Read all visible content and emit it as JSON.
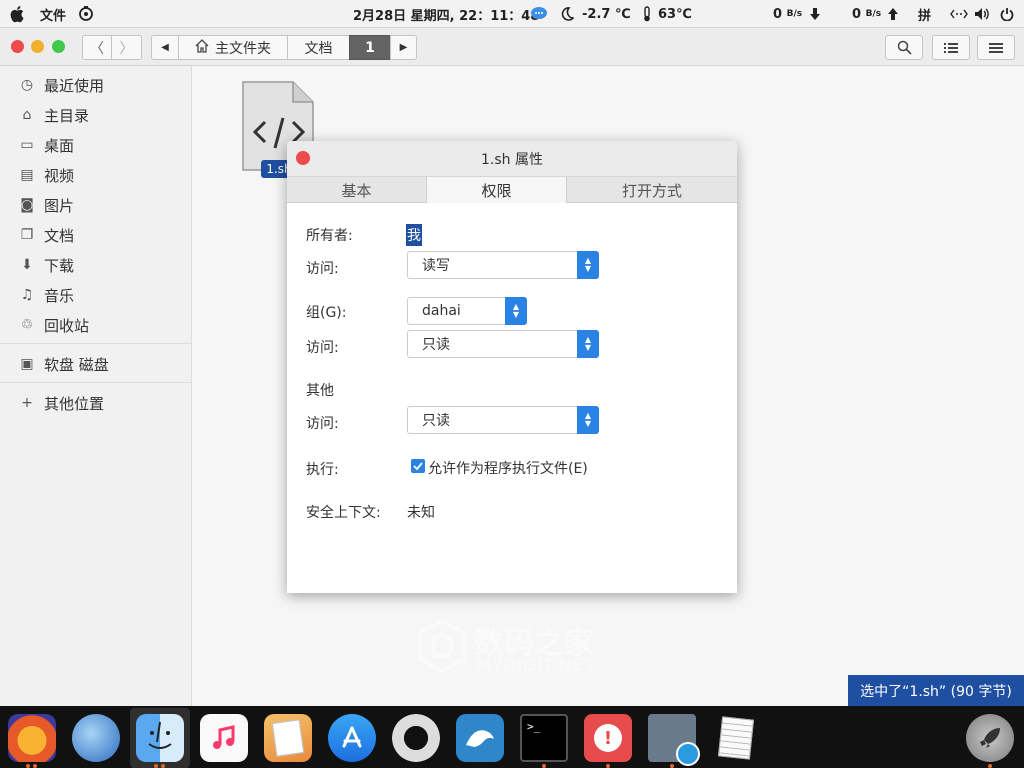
{
  "topbar": {
    "menu": "文件",
    "datetime": "2月28日 星期四, 22：11：48",
    "weather": "-2.7 ℃",
    "temp": "63℃",
    "net_down": "0",
    "net_down_unit": "B/s",
    "net_up": "0",
    "net_up_unit": "B/s",
    "ime": "拼"
  },
  "fm": {
    "breadcrumb": [
      "主文件夹",
      "文档",
      "1"
    ],
    "sidebar": [
      {
        "label": "最近使用",
        "icon": "recent-icon"
      },
      {
        "label": "主目录",
        "icon": "home-icon"
      },
      {
        "label": "桌面",
        "icon": "desktop-icon"
      },
      {
        "label": "视频",
        "icon": "video-icon"
      },
      {
        "label": "图片",
        "icon": "pictures-icon"
      },
      {
        "label": "文档",
        "icon": "documents-icon"
      },
      {
        "label": "下载",
        "icon": "downloads-icon"
      },
      {
        "label": "音乐",
        "icon": "music-icon"
      },
      {
        "label": "回收站",
        "icon": "trash-icon"
      },
      {
        "label": "软盘 磁盘",
        "icon": "floppy-icon"
      },
      {
        "label": "其他位置",
        "icon": "plus-icon"
      }
    ],
    "file_label": "1.sh",
    "status": "选中了“1.sh” (90 字节)"
  },
  "dialog": {
    "title": "1.sh 属性",
    "tabs": [
      "基本",
      "权限",
      "打开方式"
    ],
    "active_tab": "权限",
    "owner_label": "所有者:",
    "owner_value": "我",
    "access_label": "访问:",
    "owner_access": "读写",
    "group_label": "组(G):",
    "group_value": "dahai",
    "group_access": "只读",
    "others_label": "其他",
    "others_access": "只读",
    "execute_label": "执行:",
    "execute_checkbox": "允许作为程序执行文件(E)",
    "context_label": "安全上下文:",
    "context_value": "未知"
  },
  "watermark": {
    "cn": "数码之家",
    "en": "MYDIGIT.NET"
  },
  "dock": {
    "apps": [
      "firefox-icon",
      "browser-bird-icon",
      "finder-icon",
      "music-icon",
      "pages-icon",
      "app-store-icon",
      "help-lifebuoy-icon",
      "mysql-workbench-icon",
      "terminal-icon",
      "alert-icon",
      "video-sync-icon",
      "text-editor-icon",
      "launchpad-rocket-icon"
    ]
  },
  "colors": {
    "accent": "#2a83e3",
    "selection": "#1f4fa1",
    "close": "#ed4b4b"
  }
}
